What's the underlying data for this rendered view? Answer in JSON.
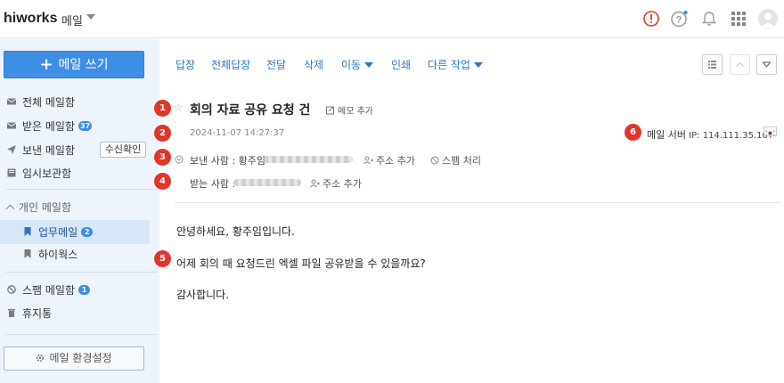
{
  "app": {
    "logo": "hiworks",
    "name": "메일"
  },
  "compose": {
    "label": "메일 쓰기"
  },
  "sidebar": {
    "all": "전체 메일함",
    "inbox": "받은 메일함",
    "inbox_count": "37",
    "sent": "보낸 메일함",
    "read_check": "수신확인",
    "drafts": "임시보관함",
    "personal_group": "개인 메일함",
    "work": "업무메일",
    "work_count": "2",
    "hiworks": "하이웍스",
    "spam": "스팸 메일함",
    "spam_count": "1",
    "trash": "휴지통",
    "settings": "메일 환경설정"
  },
  "toolbar": {
    "reply": "답장",
    "reply_all": "전체답장",
    "forward": "전달",
    "delete": "삭제",
    "move": "이동",
    "print": "인쇄",
    "other": "다른 작업"
  },
  "mail": {
    "subject": "회의 자료 공유 요청 건",
    "memo": "메모 추가",
    "date": "2024-11-07 14:27:37",
    "server_label": "메일 서버",
    "server_ip": "IP: 114.111.35.107",
    "from_label": "보낸 사람 : 황주임",
    "to_label": "받는 사람 :",
    "add_contact": "주소 추가",
    "spam_action": "스팸 처리",
    "body": [
      "안녕하세요, 황주임입니다.",
      "어제 회의 때 요청드린 엑셀 파일 공유받을 수 있을까요?",
      "감사합니다."
    ]
  },
  "markers": [
    "1",
    "2",
    "3",
    "4",
    "5",
    "6"
  ],
  "colors": {
    "accent": "#3d8ee4",
    "marker": "#e2352a",
    "link": "#2f73c9",
    "sidebar_bg": "#eef4fb"
  }
}
